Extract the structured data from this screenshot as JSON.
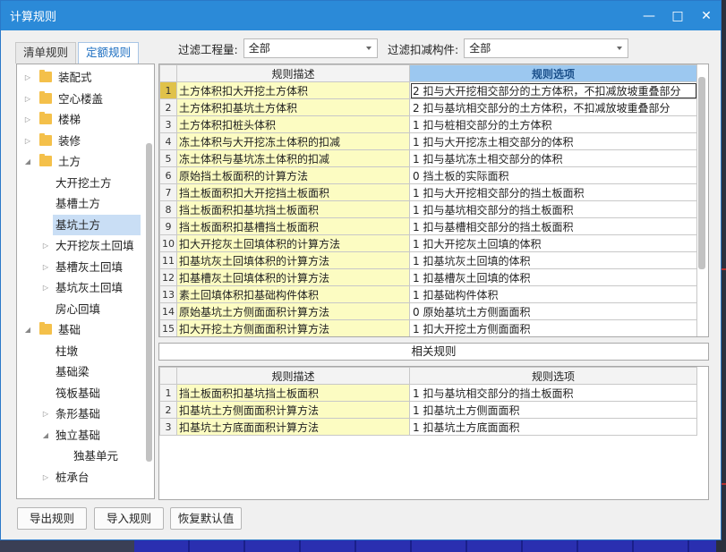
{
  "window": {
    "title": "计算规则",
    "minimize": "—",
    "maximize": "□",
    "close": "✕"
  },
  "tabs": [
    "清单规则",
    "定额规则"
  ],
  "filters": {
    "quantity_label": "过滤工程量:",
    "quantity_value": "全部",
    "component_label": "过滤扣减构件:",
    "component_value": "全部"
  },
  "tree": [
    {
      "label": "装配式",
      "level": 0,
      "folder": true,
      "caret": "▷"
    },
    {
      "label": "空心楼盖",
      "level": 0,
      "folder": true,
      "caret": "▷"
    },
    {
      "label": "楼梯",
      "level": 0,
      "folder": true,
      "caret": "▷"
    },
    {
      "label": "装修",
      "level": 0,
      "folder": true,
      "caret": "▷"
    },
    {
      "label": "土方",
      "level": 0,
      "folder": true,
      "caret": "◢"
    },
    {
      "label": "大开挖土方",
      "level": 1
    },
    {
      "label": "基槽土方",
      "level": 1
    },
    {
      "label": "基坑土方",
      "level": 1,
      "selected": true
    },
    {
      "label": "大开挖灰土回填",
      "level": 1,
      "caret": "▷"
    },
    {
      "label": "基槽灰土回填",
      "level": 1,
      "caret": "▷"
    },
    {
      "label": "基坑灰土回填",
      "level": 1,
      "caret": "▷"
    },
    {
      "label": "房心回填",
      "level": 1
    },
    {
      "label": "基础",
      "level": 0,
      "folder": true,
      "caret": "◢"
    },
    {
      "label": "柱墩",
      "level": 1
    },
    {
      "label": "基础梁",
      "level": 1
    },
    {
      "label": "筏板基础",
      "level": 1
    },
    {
      "label": "条形基础",
      "level": 1,
      "caret": "▷"
    },
    {
      "label": "独立基础",
      "level": 1,
      "caret": "◢"
    },
    {
      "label": "独基单元",
      "level": 2
    },
    {
      "label": "桩承台",
      "level": 1,
      "caret": "▷"
    }
  ],
  "rules": {
    "col_desc": "规则描述",
    "col_option": "规则选项",
    "rows": [
      {
        "n": "1",
        "desc": "土方体积扣大开挖土方体积",
        "opt": "2  扣与大开挖相交部分的土方体积，不扣减放坡重叠部分"
      },
      {
        "n": "2",
        "desc": "土方体积扣基坑土方体积",
        "opt": "2  扣与基坑相交部分的土方体积，不扣减放坡重叠部分"
      },
      {
        "n": "3",
        "desc": "土方体积扣桩头体积",
        "opt": "1  扣与桩相交部分的土方体积"
      },
      {
        "n": "4",
        "desc": "冻土体积与大开挖冻土体积的扣减",
        "opt": "1  扣与大开挖冻土相交部分的体积"
      },
      {
        "n": "5",
        "desc": "冻土体积与基坑冻土体积的扣减",
        "opt": "1  扣与基坑冻土相交部分的体积"
      },
      {
        "n": "6",
        "desc": "原始挡土板面积的计算方法",
        "opt": "0  挡土板的实际面积"
      },
      {
        "n": "7",
        "desc": "挡土板面积扣大开挖挡土板面积",
        "opt": "1  扣与大开挖相交部分的挡土板面积"
      },
      {
        "n": "8",
        "desc": "挡土板面积扣基坑挡土板面积",
        "opt": "1  扣与基坑相交部分的挡土板面积"
      },
      {
        "n": "9",
        "desc": "挡土板面积扣基槽挡土板面积",
        "opt": "1  扣与基槽相交部分的挡土板面积"
      },
      {
        "n": "10",
        "desc": "扣大开挖灰土回填体积的计算方法",
        "opt": "1 扣大开挖灰土回填的体积"
      },
      {
        "n": "11",
        "desc": "扣基坑灰土回填体积的计算方法",
        "opt": "1 扣基坑灰土回填的体积"
      },
      {
        "n": "12",
        "desc": "扣基槽灰土回填体积的计算方法",
        "opt": "1 扣基槽灰土回填的体积"
      },
      {
        "n": "13",
        "desc": "素土回填体积扣基础构件体积",
        "opt": "1 扣基础构件体积"
      },
      {
        "n": "14",
        "desc": "原始基坑土方侧面面积计算方法",
        "opt": "0 原始基坑土方侧面面积"
      },
      {
        "n": "15",
        "desc": "扣大开挖土方侧面面积计算方法",
        "opt": "1 扣大开挖土方侧面面积"
      }
    ]
  },
  "related": {
    "title": "相关规则",
    "col_desc": "规则描述",
    "col_option": "规则选项",
    "rows": [
      {
        "n": "1",
        "desc": "挡土板面积扣基坑挡土板面积",
        "opt": "1  扣与基坑相交部分的挡土板面积"
      },
      {
        "n": "2",
        "desc": "扣基坑土方侧面面积计算方法",
        "opt": "1 扣基坑土方侧面面积"
      },
      {
        "n": "3",
        "desc": "扣基坑土方底面面积计算方法",
        "opt": "1 扣基坑土方底面面积"
      }
    ]
  },
  "buttons": {
    "export": "导出规则",
    "import": "导入规则",
    "restore": "恢复默认值"
  }
}
